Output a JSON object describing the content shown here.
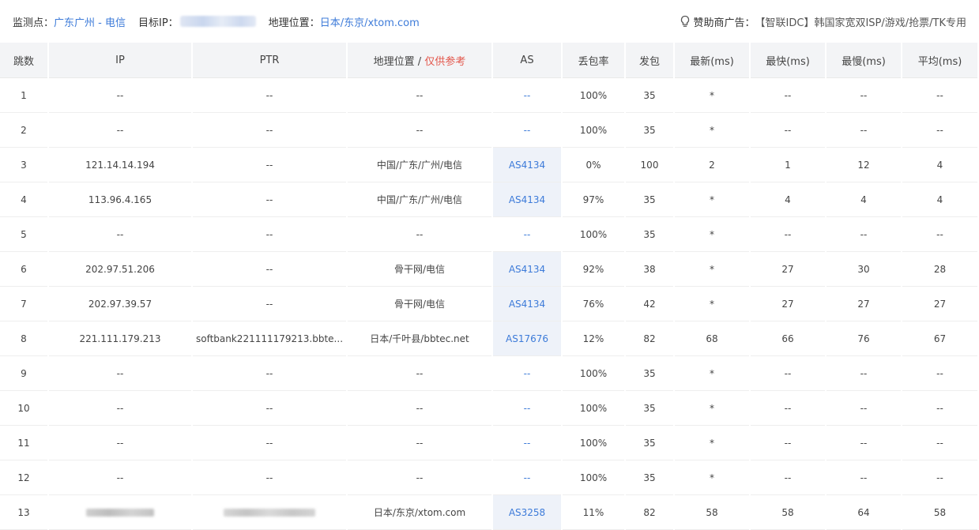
{
  "header": {
    "monitor_label": "监测点：",
    "monitor_value": "广东广州 - 电信",
    "target_label": "目标IP：",
    "geo_label": "地理位置：",
    "geo_value": "日本/东京/xtom.com",
    "sponsor_icon": "lightbulb-icon",
    "sponsor_label": "赞助商广告：",
    "sponsor_text": "【智联IDC】韩国家宽双ISP/游戏/抢票/TK专用"
  },
  "table": {
    "headers": {
      "hop": "跳数",
      "ip": "IP",
      "ptr": "PTR",
      "geo": "地理位置 / ",
      "geo_note": "仅供参考",
      "as": "AS",
      "loss": "丢包率",
      "sent": "发包",
      "last": "最新(ms)",
      "best": "最快(ms)",
      "worst": "最慢(ms)",
      "avg": "平均(ms)"
    },
    "rows": [
      {
        "hop": "1",
        "ip": "--",
        "ptr": "--",
        "geo": "--",
        "as": "--",
        "loss": "100%",
        "sent": "35",
        "last": "*",
        "best": "--",
        "worst": "--",
        "avg": "--"
      },
      {
        "hop": "2",
        "ip": "--",
        "ptr": "--",
        "geo": "--",
        "as": "--",
        "loss": "100%",
        "sent": "35",
        "last": "*",
        "best": "--",
        "worst": "--",
        "avg": "--"
      },
      {
        "hop": "3",
        "ip": "121.14.14.194",
        "ptr": "--",
        "geo": "中国/广东/广州/电信",
        "as": "AS4134",
        "loss": "0%",
        "sent": "100",
        "last": "2",
        "best": "1",
        "worst": "12",
        "avg": "4"
      },
      {
        "hop": "4",
        "ip": "113.96.4.165",
        "ptr": "--",
        "geo": "中国/广东/广州/电信",
        "as": "AS4134",
        "loss": "97%",
        "sent": "35",
        "last": "*",
        "best": "4",
        "worst": "4",
        "avg": "4"
      },
      {
        "hop": "5",
        "ip": "--",
        "ptr": "--",
        "geo": "--",
        "as": "--",
        "loss": "100%",
        "sent": "35",
        "last": "*",
        "best": "--",
        "worst": "--",
        "avg": "--"
      },
      {
        "hop": "6",
        "ip": "202.97.51.206",
        "ptr": "--",
        "geo": "骨干网/电信",
        "as": "AS4134",
        "loss": "92%",
        "sent": "38",
        "last": "*",
        "best": "27",
        "worst": "30",
        "avg": "28"
      },
      {
        "hop": "7",
        "ip": "202.97.39.57",
        "ptr": "--",
        "geo": "骨干网/电信",
        "as": "AS4134",
        "loss": "76%",
        "sent": "42",
        "last": "*",
        "best": "27",
        "worst": "27",
        "avg": "27"
      },
      {
        "hop": "8",
        "ip": "221.111.179.213",
        "ptr": "softbank221111179213.bbte...",
        "geo": "日本/千叶县/bbtec.net",
        "as": "AS17676",
        "loss": "12%",
        "sent": "82",
        "last": "68",
        "best": "66",
        "worst": "76",
        "avg": "67"
      },
      {
        "hop": "9",
        "ip": "--",
        "ptr": "--",
        "geo": "--",
        "as": "--",
        "loss": "100%",
        "sent": "35",
        "last": "*",
        "best": "--",
        "worst": "--",
        "avg": "--"
      },
      {
        "hop": "10",
        "ip": "--",
        "ptr": "--",
        "geo": "--",
        "as": "--",
        "loss": "100%",
        "sent": "35",
        "last": "*",
        "best": "--",
        "worst": "--",
        "avg": "--"
      },
      {
        "hop": "11",
        "ip": "--",
        "ptr": "--",
        "geo": "--",
        "as": "--",
        "loss": "100%",
        "sent": "35",
        "last": "*",
        "best": "--",
        "worst": "--",
        "avg": "--"
      },
      {
        "hop": "12",
        "ip": "--",
        "ptr": "--",
        "geo": "--",
        "as": "--",
        "loss": "100%",
        "sent": "35",
        "last": "*",
        "best": "--",
        "worst": "--",
        "avg": "--"
      },
      {
        "hop": "13",
        "ip": "",
        "ptr": "",
        "geo": "日本/东京/xtom.com",
        "as": "AS3258",
        "loss": "11%",
        "sent": "82",
        "last": "58",
        "best": "58",
        "worst": "64",
        "avg": "58"
      }
    ]
  },
  "colors": {
    "link": "#3d7bd9",
    "warn": "#e3574c",
    "header_bg": "#f3f4f6",
    "as_highlight": "#eef2f9"
  }
}
